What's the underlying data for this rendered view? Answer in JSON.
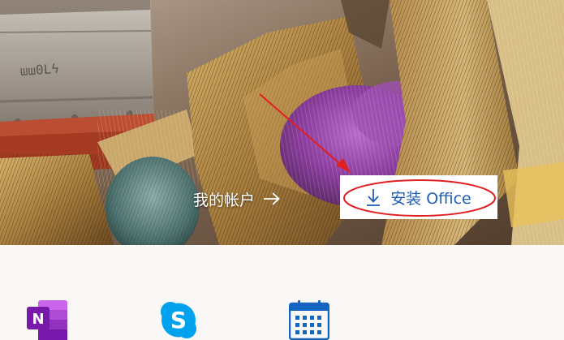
{
  "hero": {
    "account_label": "我的帐户",
    "account_arrow_icon": "arrow-right-icon",
    "install_label": "安装 Office",
    "install_icon": "download-arrow-icon",
    "install_color": "#1f5db8",
    "annotation_color": "#e02020"
  },
  "apps": [
    {
      "name": "OneNote",
      "icon": "onenote-icon",
      "color": "#7719aa"
    },
    {
      "name": "Skype",
      "icon": "skype-icon",
      "color": "#00a2ed"
    },
    {
      "name": "Calendar",
      "icon": "calendar-icon",
      "color": "#1565c0"
    }
  ]
}
